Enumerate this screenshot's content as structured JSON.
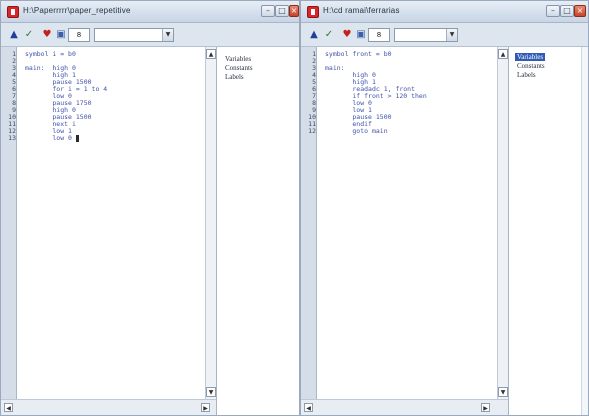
{
  "left_window": {
    "title": "H:\\Paperrrrr\\paper_repetitive",
    "line_numbers": [
      "1",
      "2",
      "3",
      "4",
      "5",
      "6",
      "7",
      "8",
      "9",
      "10",
      "11",
      "12",
      "13"
    ],
    "code_lines": [
      "symbol i = b0",
      "",
      "main:  high 0",
      "       high 1",
      "       pause 1500",
      "       for i = 1 to 4",
      "       low 0",
      "       pause 1750",
      "       high 0",
      "       pause 1500",
      "       next i",
      "       low 1",
      "       low 0"
    ],
    "symbols": [
      "Variables",
      "Constants",
      "Labels"
    ],
    "speed_value": "8"
  },
  "right_window": {
    "title": "H:\\cd ramai\\ferrarias",
    "line_numbers": [
      "1",
      "2",
      "3",
      "4",
      "5",
      "6",
      "7",
      "8",
      "9",
      "10",
      "11",
      "12"
    ],
    "code_lines": [
      "symbol front = b0",
      "",
      "main:",
      "       high 0",
      "       high 1",
      "       readadc 1, front",
      "       if front > 120 then",
      "       low 0",
      "       low 1",
      "       pause 1500",
      "       endif",
      "       goto main"
    ],
    "symbols": [
      "Variables",
      "Constants",
      "Labels"
    ],
    "selected_symbol": "Variables",
    "speed_value": "8"
  }
}
